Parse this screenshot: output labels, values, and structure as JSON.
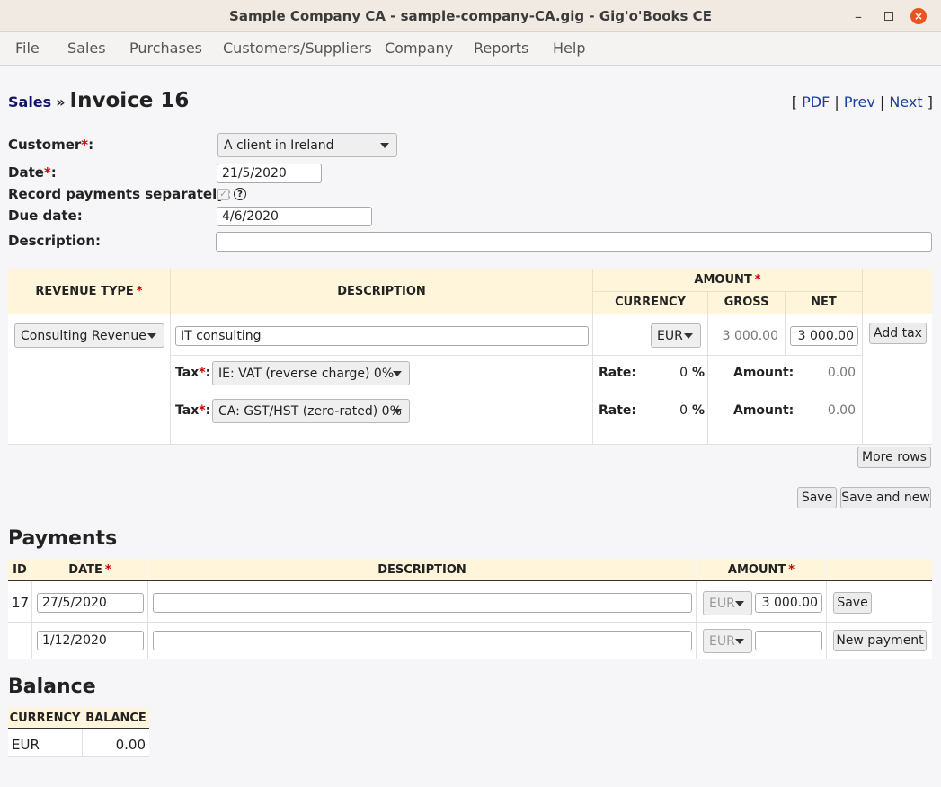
{
  "window": {
    "title": "Sample Company CA - sample-company-CA.gig - Gig'o'Books CE",
    "minimize": "–",
    "close": "×"
  },
  "menu": [
    "File",
    "Sales",
    "Purchases",
    "Customers/Suppliers",
    "Company",
    "Reports",
    "Help"
  ],
  "header": {
    "breadcrumb": "Sales",
    "separator": "»",
    "title": "Invoice 16",
    "links": {
      "open": "[",
      "pdf": "PDF",
      "bar1": "|",
      "prev": "Prev",
      "bar2": "|",
      "next": "Next",
      "close": "]"
    }
  },
  "form": {
    "customer_label": "Customer",
    "customer_value": "A client in Ireland",
    "date_label": "Date",
    "date_value": "21/5/2020",
    "record_label": "Record payments separately:",
    "record_checked": true,
    "help": "?",
    "due_label": "Due date:",
    "due_value": "4/6/2020",
    "description_label": "Description:",
    "description_value": "",
    "asterisk": "*",
    "colon": ":"
  },
  "lines": {
    "headers": {
      "revenue_type": "REVENUE TYPE",
      "description": "DESCRIPTION",
      "amount": "AMOUNT",
      "currency": "CURRENCY",
      "gross": "GROSS",
      "net": "NET"
    },
    "row": {
      "revenue_type": "Consulting Revenue",
      "description": "IT consulting",
      "currency": "EUR",
      "gross": "3 000.00",
      "net": "3 000.00",
      "add_tax": "Add tax"
    },
    "taxes": [
      {
        "label": "Tax",
        "value": "IE: VAT (reverse charge) 0%",
        "rate_label": "Rate:",
        "rate": "0",
        "pct": "%",
        "amount_label": "Amount:",
        "amount": "0.00"
      },
      {
        "label": "Tax",
        "value": "CA: GST/HST (zero-rated) 0%",
        "rate_label": "Rate:",
        "rate": "0",
        "pct": "%",
        "amount_label": "Amount:",
        "amount": "0.00"
      }
    ],
    "more_rows": "More rows"
  },
  "actions": {
    "save": "Save",
    "save_and_new": "Save and new"
  },
  "payments": {
    "heading": "Payments",
    "headers": {
      "id": "ID",
      "date": "DATE",
      "description": "DESCRIPTION",
      "amount": "AMOUNT"
    },
    "rows": [
      {
        "id": "17",
        "date": "27/5/2020",
        "description": "",
        "currency": "EUR",
        "amount": "3 000.00",
        "action": "Save"
      },
      {
        "id": "",
        "date": "1/12/2020",
        "description": "",
        "currency": "EUR",
        "amount": "",
        "action": "New payment"
      }
    ]
  },
  "balance": {
    "heading": "Balance",
    "headers": {
      "currency": "CURRENCY",
      "balance": "BALANCE"
    },
    "rows": [
      {
        "currency": "EUR",
        "balance": "0.00"
      }
    ]
  }
}
